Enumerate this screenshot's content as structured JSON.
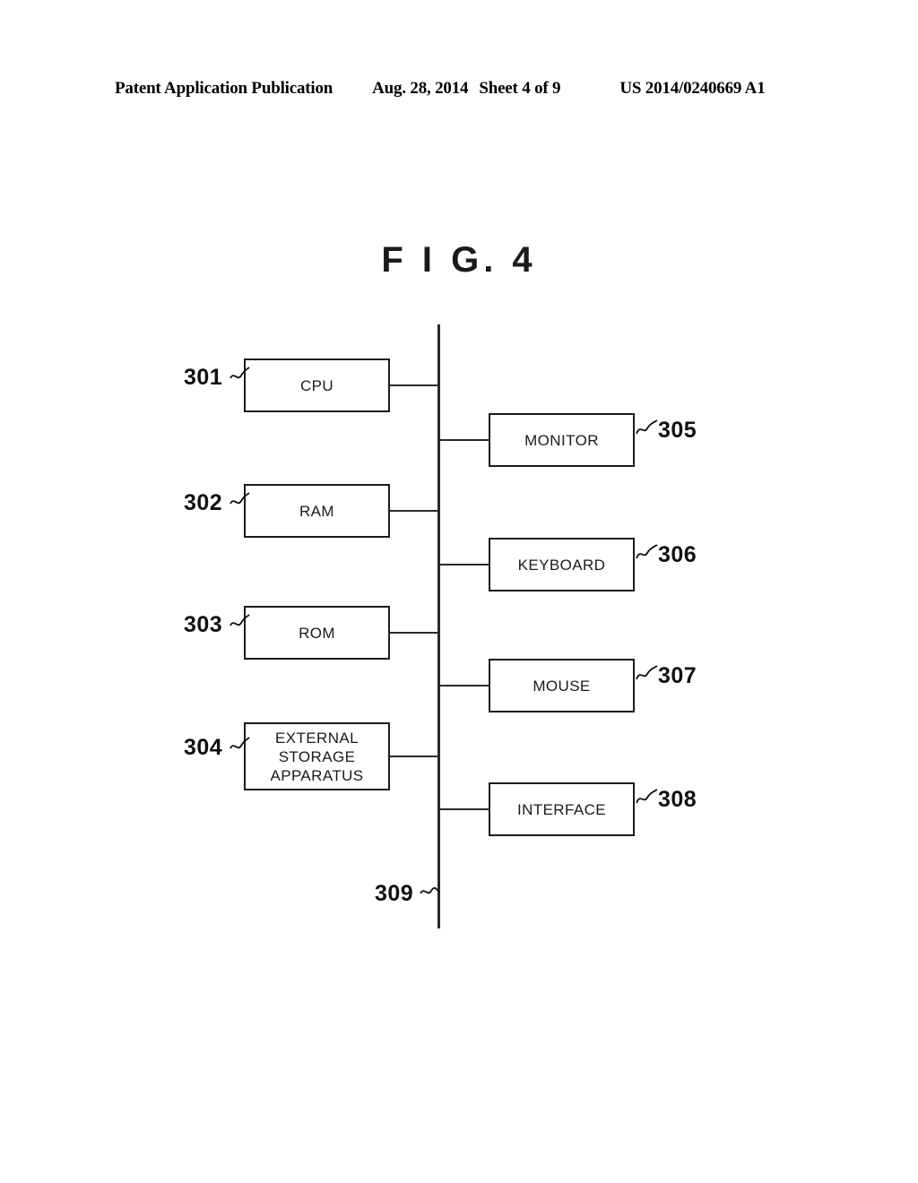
{
  "header": {
    "publication": "Patent Application Publication",
    "date": "Aug. 28, 2014",
    "sheet": "Sheet 4 of 9",
    "patent_number": "US 2014/0240669 A1"
  },
  "figure": {
    "title": "F I G. 4"
  },
  "diagram": {
    "left_units": [
      {
        "ref": "301",
        "label_lines": [
          "CPU"
        ]
      },
      {
        "ref": "302",
        "label_lines": [
          "RAM"
        ]
      },
      {
        "ref": "303",
        "label_lines": [
          "ROM"
        ]
      },
      {
        "ref": "304",
        "label_lines": [
          "EXTERNAL",
          "STORAGE",
          "APPARATUS"
        ]
      }
    ],
    "right_units": [
      {
        "ref": "305",
        "label_lines": [
          "MONITOR"
        ]
      },
      {
        "ref": "306",
        "label_lines": [
          "KEYBOARD"
        ]
      },
      {
        "ref": "307",
        "label_lines": [
          "MOUSE"
        ]
      },
      {
        "ref": "308",
        "label_lines": [
          "INTERFACE"
        ]
      }
    ],
    "bus": {
      "ref": "309"
    }
  }
}
